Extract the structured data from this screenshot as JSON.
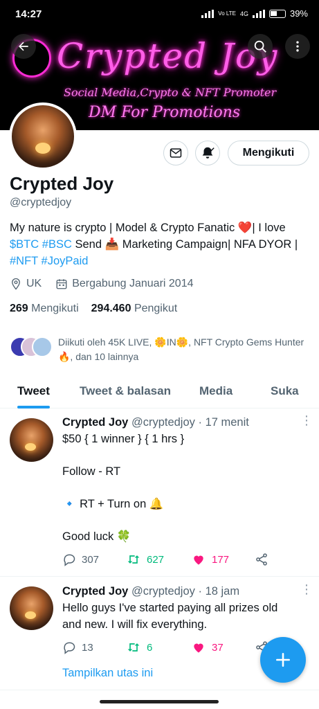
{
  "status_bar": {
    "time": "14:27",
    "network": "4G",
    "volte": "Vo LTE",
    "battery": "39%"
  },
  "banner": {
    "title": "Crypted Joy",
    "line1": "Social Media,Crypto & NFT Promoter",
    "line2": "DM For Promotions"
  },
  "profile": {
    "follow_button": "Mengikuti",
    "name": "Crypted Joy",
    "handle": "@cryptedjoy",
    "bio": {
      "part1": "My nature is crypto | Model & Crypto Fanatic ",
      "heart": "❤️",
      "part2": "| I love ",
      "tag_btc": "$BTC",
      "tag_bsc": "#BSC",
      "part3": " Send ",
      "emoji_box": "📥",
      "part4": " Marketing Campaign| NFA DYOR | ",
      "tag_nft": "#NFT",
      "tag_joypaid": "#JoyPaid"
    },
    "location": "UK",
    "joined": "Bergabung Januari 2014",
    "following_count": "269",
    "following_label": "Mengikuti",
    "followers_count": "294.460",
    "followers_label": "Pengikut",
    "followed_by": "Diikuti oleh 45K LIVE, 🌼IN🌼, NFT Crypto Gems Hunter🔥, dan 10 lainnya"
  },
  "tabs": [
    {
      "label": "Tweet",
      "active": true
    },
    {
      "label": "Tweet & balasan",
      "active": false
    },
    {
      "label": "Media",
      "active": false
    },
    {
      "label": "Suka",
      "active": false
    }
  ],
  "tweets": [
    {
      "name": "Crypted Joy",
      "handle": "@cryptedjoy",
      "time": "· 17 menit",
      "lines": [
        "$50 { 1 winner } { 1 hrs }",
        "",
        "Follow - RT",
        "",
        "🔹 RT + Turn on 🔔",
        "",
        "Good luck 🍀"
      ],
      "replies": "307",
      "retweets": "627",
      "likes": "177"
    },
    {
      "name": "Crypted Joy",
      "handle": "@cryptedjoy",
      "time": "· 18 jam",
      "lines": [
        "Hello guys I've started paying all prizes old and new. I will fix everything."
      ],
      "replies": "13",
      "retweets": "6",
      "likes": "37",
      "show_thread": "Tampilkan utas ini"
    }
  ],
  "icons": {
    "back": "back-arrow-icon",
    "search": "search-icon",
    "more": "more-vertical-icon",
    "message": "envelope-icon",
    "notify": "bell-icon",
    "location": "location-pin-icon",
    "calendar": "calendar-icon",
    "reply": "reply-icon",
    "retweet": "retweet-icon",
    "like": "heart-icon",
    "share": "share-icon",
    "compose": "plus-icon"
  },
  "colors": {
    "accent": "#1d9bf0",
    "retweet": "#00ba7c",
    "like": "#f91880",
    "neon": "#ff2bd6"
  }
}
